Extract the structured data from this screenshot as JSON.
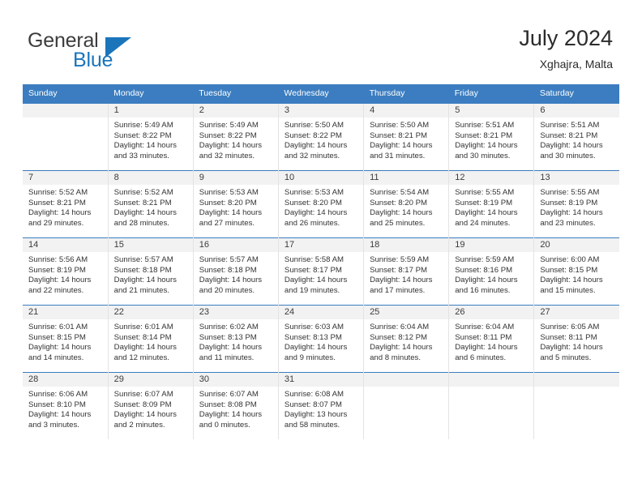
{
  "brand": {
    "word_general": "General",
    "word_blue": "Blue",
    "triangle_color": "#1b75bb"
  },
  "header": {
    "title": "July 2024",
    "subtitle": "Xghajra, Malta",
    "accent_color": "#3b7dc0"
  },
  "weekday_headers": [
    "Sunday",
    "Monday",
    "Tuesday",
    "Wednesday",
    "Thursday",
    "Friday",
    "Saturday"
  ],
  "labels": {
    "sunrise_prefix": "Sunrise:",
    "sunset_prefix": "Sunset:",
    "daylight_prefix": "Daylight:"
  },
  "weeks": [
    [
      {
        "day": "",
        "sunrise": "",
        "sunset": "",
        "daylight_line1": "",
        "daylight_line2": "",
        "empty": true
      },
      {
        "day": "1",
        "sunrise": "Sunrise: 5:49 AM",
        "sunset": "Sunset: 8:22 PM",
        "daylight_line1": "Daylight: 14 hours",
        "daylight_line2": "and 33 minutes."
      },
      {
        "day": "2",
        "sunrise": "Sunrise: 5:49 AM",
        "sunset": "Sunset: 8:22 PM",
        "daylight_line1": "Daylight: 14 hours",
        "daylight_line2": "and 32 minutes."
      },
      {
        "day": "3",
        "sunrise": "Sunrise: 5:50 AM",
        "sunset": "Sunset: 8:22 PM",
        "daylight_line1": "Daylight: 14 hours",
        "daylight_line2": "and 32 minutes."
      },
      {
        "day": "4",
        "sunrise": "Sunrise: 5:50 AM",
        "sunset": "Sunset: 8:21 PM",
        "daylight_line1": "Daylight: 14 hours",
        "daylight_line2": "and 31 minutes."
      },
      {
        "day": "5",
        "sunrise": "Sunrise: 5:51 AM",
        "sunset": "Sunset: 8:21 PM",
        "daylight_line1": "Daylight: 14 hours",
        "daylight_line2": "and 30 minutes."
      },
      {
        "day": "6",
        "sunrise": "Sunrise: 5:51 AM",
        "sunset": "Sunset: 8:21 PM",
        "daylight_line1": "Daylight: 14 hours",
        "daylight_line2": "and 30 minutes."
      }
    ],
    [
      {
        "day": "7",
        "sunrise": "Sunrise: 5:52 AM",
        "sunset": "Sunset: 8:21 PM",
        "daylight_line1": "Daylight: 14 hours",
        "daylight_line2": "and 29 minutes."
      },
      {
        "day": "8",
        "sunrise": "Sunrise: 5:52 AM",
        "sunset": "Sunset: 8:21 PM",
        "daylight_line1": "Daylight: 14 hours",
        "daylight_line2": "and 28 minutes."
      },
      {
        "day": "9",
        "sunrise": "Sunrise: 5:53 AM",
        "sunset": "Sunset: 8:20 PM",
        "daylight_line1": "Daylight: 14 hours",
        "daylight_line2": "and 27 minutes."
      },
      {
        "day": "10",
        "sunrise": "Sunrise: 5:53 AM",
        "sunset": "Sunset: 8:20 PM",
        "daylight_line1": "Daylight: 14 hours",
        "daylight_line2": "and 26 minutes."
      },
      {
        "day": "11",
        "sunrise": "Sunrise: 5:54 AM",
        "sunset": "Sunset: 8:20 PM",
        "daylight_line1": "Daylight: 14 hours",
        "daylight_line2": "and 25 minutes."
      },
      {
        "day": "12",
        "sunrise": "Sunrise: 5:55 AM",
        "sunset": "Sunset: 8:19 PM",
        "daylight_line1": "Daylight: 14 hours",
        "daylight_line2": "and 24 minutes."
      },
      {
        "day": "13",
        "sunrise": "Sunrise: 5:55 AM",
        "sunset": "Sunset: 8:19 PM",
        "daylight_line1": "Daylight: 14 hours",
        "daylight_line2": "and 23 minutes."
      }
    ],
    [
      {
        "day": "14",
        "sunrise": "Sunrise: 5:56 AM",
        "sunset": "Sunset: 8:19 PM",
        "daylight_line1": "Daylight: 14 hours",
        "daylight_line2": "and 22 minutes."
      },
      {
        "day": "15",
        "sunrise": "Sunrise: 5:57 AM",
        "sunset": "Sunset: 8:18 PM",
        "daylight_line1": "Daylight: 14 hours",
        "daylight_line2": "and 21 minutes."
      },
      {
        "day": "16",
        "sunrise": "Sunrise: 5:57 AM",
        "sunset": "Sunset: 8:18 PM",
        "daylight_line1": "Daylight: 14 hours",
        "daylight_line2": "and 20 minutes."
      },
      {
        "day": "17",
        "sunrise": "Sunrise: 5:58 AM",
        "sunset": "Sunset: 8:17 PM",
        "daylight_line1": "Daylight: 14 hours",
        "daylight_line2": "and 19 minutes."
      },
      {
        "day": "18",
        "sunrise": "Sunrise: 5:59 AM",
        "sunset": "Sunset: 8:17 PM",
        "daylight_line1": "Daylight: 14 hours",
        "daylight_line2": "and 17 minutes."
      },
      {
        "day": "19",
        "sunrise": "Sunrise: 5:59 AM",
        "sunset": "Sunset: 8:16 PM",
        "daylight_line1": "Daylight: 14 hours",
        "daylight_line2": "and 16 minutes."
      },
      {
        "day": "20",
        "sunrise": "Sunrise: 6:00 AM",
        "sunset": "Sunset: 8:15 PM",
        "daylight_line1": "Daylight: 14 hours",
        "daylight_line2": "and 15 minutes."
      }
    ],
    [
      {
        "day": "21",
        "sunrise": "Sunrise: 6:01 AM",
        "sunset": "Sunset: 8:15 PM",
        "daylight_line1": "Daylight: 14 hours",
        "daylight_line2": "and 14 minutes."
      },
      {
        "day": "22",
        "sunrise": "Sunrise: 6:01 AM",
        "sunset": "Sunset: 8:14 PM",
        "daylight_line1": "Daylight: 14 hours",
        "daylight_line2": "and 12 minutes."
      },
      {
        "day": "23",
        "sunrise": "Sunrise: 6:02 AM",
        "sunset": "Sunset: 8:13 PM",
        "daylight_line1": "Daylight: 14 hours",
        "daylight_line2": "and 11 minutes."
      },
      {
        "day": "24",
        "sunrise": "Sunrise: 6:03 AM",
        "sunset": "Sunset: 8:13 PM",
        "daylight_line1": "Daylight: 14 hours",
        "daylight_line2": "and 9 minutes."
      },
      {
        "day": "25",
        "sunrise": "Sunrise: 6:04 AM",
        "sunset": "Sunset: 8:12 PM",
        "daylight_line1": "Daylight: 14 hours",
        "daylight_line2": "and 8 minutes."
      },
      {
        "day": "26",
        "sunrise": "Sunrise: 6:04 AM",
        "sunset": "Sunset: 8:11 PM",
        "daylight_line1": "Daylight: 14 hours",
        "daylight_line2": "and 6 minutes."
      },
      {
        "day": "27",
        "sunrise": "Sunrise: 6:05 AM",
        "sunset": "Sunset: 8:11 PM",
        "daylight_line1": "Daylight: 14 hours",
        "daylight_line2": "and 5 minutes."
      }
    ],
    [
      {
        "day": "28",
        "sunrise": "Sunrise: 6:06 AM",
        "sunset": "Sunset: 8:10 PM",
        "daylight_line1": "Daylight: 14 hours",
        "daylight_line2": "and 3 minutes."
      },
      {
        "day": "29",
        "sunrise": "Sunrise: 6:07 AM",
        "sunset": "Sunset: 8:09 PM",
        "daylight_line1": "Daylight: 14 hours",
        "daylight_line2": "and 2 minutes."
      },
      {
        "day": "30",
        "sunrise": "Sunrise: 6:07 AM",
        "sunset": "Sunset: 8:08 PM",
        "daylight_line1": "Daylight: 14 hours",
        "daylight_line2": "and 0 minutes."
      },
      {
        "day": "31",
        "sunrise": "Sunrise: 6:08 AM",
        "sunset": "Sunset: 8:07 PM",
        "daylight_line1": "Daylight: 13 hours",
        "daylight_line2": "and 58 minutes."
      },
      {
        "day": "",
        "sunrise": "",
        "sunset": "",
        "daylight_line1": "",
        "daylight_line2": "",
        "empty": true
      },
      {
        "day": "",
        "sunrise": "",
        "sunset": "",
        "daylight_line1": "",
        "daylight_line2": "",
        "empty": true
      },
      {
        "day": "",
        "sunrise": "",
        "sunset": "",
        "daylight_line1": "",
        "daylight_line2": "",
        "empty": true
      }
    ]
  ]
}
